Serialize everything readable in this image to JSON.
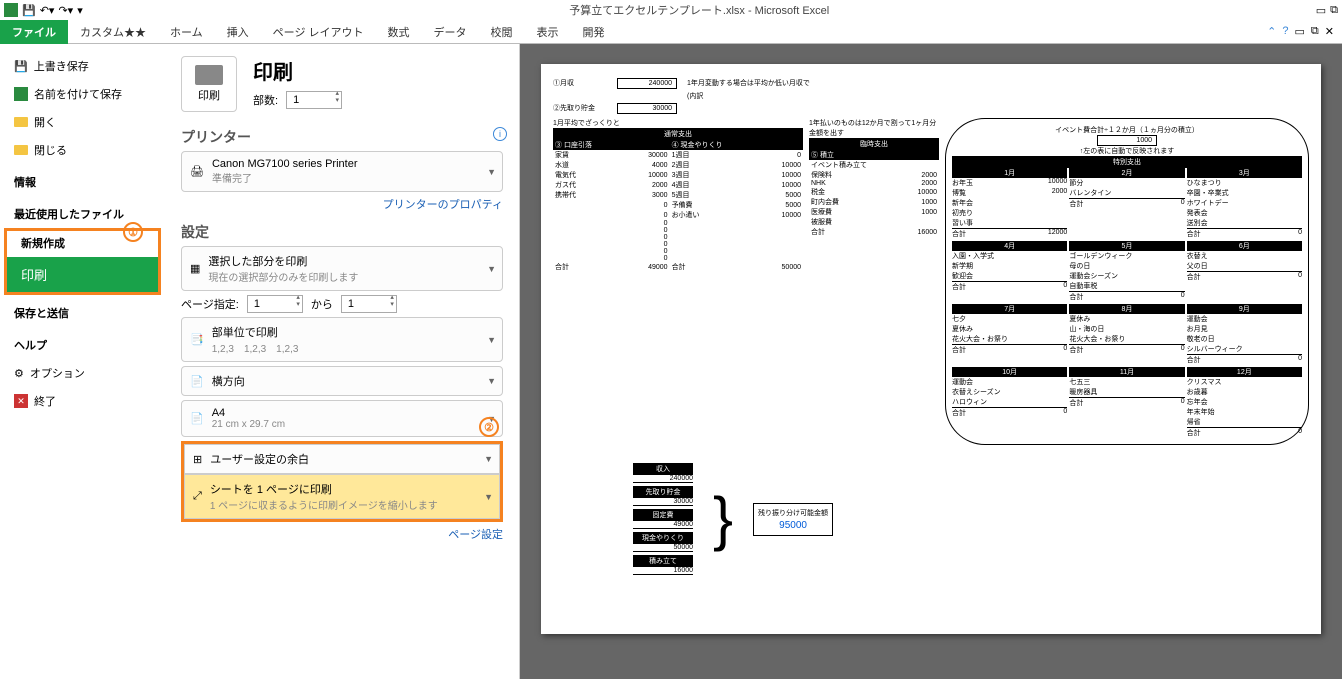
{
  "title": "予算立てエクセルテンプレート.xlsx - Microsoft Excel",
  "tabs": {
    "file": "ファイル",
    "custom": "カスタム★★",
    "home": "ホーム",
    "insert": "挿入",
    "layout": "ページ レイアウト",
    "formula": "数式",
    "data": "データ",
    "review": "校閲",
    "view": "表示",
    "dev": "開発"
  },
  "sidebar": {
    "save": "上書き保存",
    "saveas": "名前を付けて保存",
    "open": "開く",
    "close": "閉じる",
    "info": "情報",
    "recent": "最近使用したファイル",
    "new": "新規作成",
    "print": "印刷",
    "send": "保存と送信",
    "help": "ヘルプ",
    "options": "オプション",
    "exit": "終了"
  },
  "annot": {
    "one": "①",
    "two": "②"
  },
  "center": {
    "print": "印刷",
    "copies": "部数:",
    "copies_val": "1",
    "printbtn": "印刷",
    "printer": "プリンター",
    "printer_name": "Canon MG7100 series Printer",
    "printer_status": "準備完了",
    "printer_link": "プリンターのプロパティ",
    "settings": "設定",
    "sel1_t": "選択した部分を印刷",
    "sel1_s": "現在の選択部分のみを印刷します",
    "pages": "ページ指定:",
    "from": "1",
    "to_lbl": "から",
    "to": "1",
    "sel2_t": "部単位で印刷",
    "sel2_s": "1,2,3　1,2,3　1,2,3",
    "sel3_t": "横方向",
    "sel4_t": "A4",
    "sel4_s": "21 cm x 29.7 cm",
    "sel5_t": "ユーザー設定の余白",
    "sel6_t": "シートを 1 ページに印刷",
    "sel6_s": "1 ページに収まるように印刷イメージを縮小します",
    "page_setup": "ページ設定"
  },
  "doc": {
    "income_lbl": "①月収",
    "income_val": "240000",
    "income_note": "1年月変動する場合は平均か低い月収で",
    "income_sub": "(内訳",
    "savings_lbl": "②先取り貯金",
    "savings_val": "30000",
    "left_title": "1月平均でざっくりと",
    "left_h": "通常支出",
    "left_c1": "③ 口座引落",
    "left_c2": "④ 現金やりくり",
    "rows_l": [
      [
        "家賃",
        "30000",
        "1週目",
        "0"
      ],
      [
        "水道",
        "4000",
        "2週目",
        "10000"
      ],
      [
        "電気代",
        "10000",
        "3週目",
        "10000"
      ],
      [
        "ガス代",
        "2000",
        "4週目",
        "10000"
      ],
      [
        "携帯代",
        "3000",
        "5週目",
        "5000"
      ],
      [
        "",
        "0",
        "予備費",
        "5000"
      ],
      [
        "",
        "0",
        "お小遣い",
        "10000"
      ],
      [
        "",
        "0",
        "",
        ""
      ],
      [
        "",
        "0",
        "",
        ""
      ],
      [
        "",
        "0",
        "",
        ""
      ],
      [
        "",
        "0",
        "",
        ""
      ],
      [
        "",
        "0",
        "",
        ""
      ],
      [
        "",
        "0",
        "",
        ""
      ]
    ],
    "sum_l": "合計",
    "sum_l1": "49000",
    "sum_l2": "50000",
    "mid_note": "1年払いのものは12か月で割って1ヶ月分金額を出す",
    "mid_h": "臨時支出",
    "mid_c": "⑤ 積立",
    "rows_m": [
      [
        "イベント積み立て",
        ""
      ],
      [
        "",
        ""
      ],
      [
        "保険料",
        "2000"
      ],
      [
        "",
        ""
      ],
      [
        "NHK",
        "2000"
      ],
      [
        "",
        ""
      ],
      [
        "税金",
        "10000"
      ],
      [
        "",
        ""
      ],
      [
        "町内会費",
        "1000"
      ],
      [
        "",
        ""
      ],
      [
        "医療費",
        "1000"
      ],
      [
        "",
        ""
      ],
      [
        "被服費",
        ""
      ]
    ],
    "sum_m": "16000",
    "sum_labels": [
      "収入",
      "先取り貯金",
      "固定費",
      "現金やりくり",
      "積み立て"
    ],
    "sum_vals": [
      "240000",
      "30000",
      "49000",
      "50000",
      "16000"
    ],
    "res_lbl": "残り振り分け可能金額",
    "res_val": "95000",
    "ev_title": "イベント費合計÷１２か月（１ヵ月分の積立）",
    "ev_val": "1000",
    "ev_note": "↑左の表に自動で反映されます",
    "ev_h": "特別支出",
    "months": [
      {
        "n": "1月",
        "items": [
          [
            "お年玉",
            "10000"
          ],
          [
            "博覧",
            "2000"
          ],
          [
            "新年会",
            ""
          ],
          [
            "初売り",
            ""
          ],
          [
            "習い事",
            ""
          ]
        ],
        "sum": "12000"
      },
      {
        "n": "2月",
        "items": [
          [
            "節分",
            ""
          ],
          [
            "バレンタイン",
            ""
          ]
        ],
        "sum": "0"
      },
      {
        "n": "3月",
        "items": [
          [
            "ひなまつり",
            ""
          ],
          [
            "卒園・卒業式",
            ""
          ],
          [
            "ホワイトデー",
            ""
          ],
          [
            "発表会",
            ""
          ],
          [
            "送別会",
            ""
          ]
        ],
        "sum": "0"
      },
      {
        "n": "4月",
        "items": [
          [
            "入園・入学式",
            ""
          ],
          [
            "新学期",
            ""
          ],
          [
            "歓迎会",
            ""
          ]
        ],
        "sum": "0"
      },
      {
        "n": "5月",
        "items": [
          [
            "ゴールデンウィーク",
            ""
          ],
          [
            "母の日",
            ""
          ],
          [
            "運動会シーズン",
            ""
          ],
          [
            "自動車税",
            ""
          ]
        ],
        "sum": "0"
      },
      {
        "n": "6月",
        "items": [
          [
            "衣替え",
            ""
          ],
          [
            "父の日",
            ""
          ]
        ],
        "sum": "0"
      },
      {
        "n": "7月",
        "items": [
          [
            "七夕",
            ""
          ],
          [
            "夏休み",
            ""
          ],
          [
            "花火大会・お祭り",
            ""
          ]
        ],
        "sum": "0"
      },
      {
        "n": "8月",
        "items": [
          [
            "夏休み",
            ""
          ],
          [
            "山・海の日",
            ""
          ],
          [
            "花火大会・お祭り",
            ""
          ]
        ],
        "sum": "0"
      },
      {
        "n": "9月",
        "items": [
          [
            "運動会",
            ""
          ],
          [
            "お月見",
            ""
          ],
          [
            "敬老の日",
            ""
          ],
          [
            "シルバーウィーク",
            ""
          ]
        ],
        "sum": "0"
      },
      {
        "n": "10月",
        "items": [
          [
            "運動会",
            ""
          ],
          [
            "衣替えシーズン",
            ""
          ],
          [
            "ハロウィン",
            ""
          ]
        ],
        "sum": "0"
      },
      {
        "n": "11月",
        "items": [
          [
            "七五三",
            ""
          ],
          [
            "暖房器具",
            ""
          ]
        ],
        "sum": "0"
      },
      {
        "n": "12月",
        "items": [
          [
            "クリスマス",
            ""
          ],
          [
            "お歳暮",
            ""
          ],
          [
            "忘年会",
            ""
          ],
          [
            "年末年始",
            ""
          ],
          [
            "帰省",
            ""
          ]
        ],
        "sum": "0"
      }
    ]
  }
}
